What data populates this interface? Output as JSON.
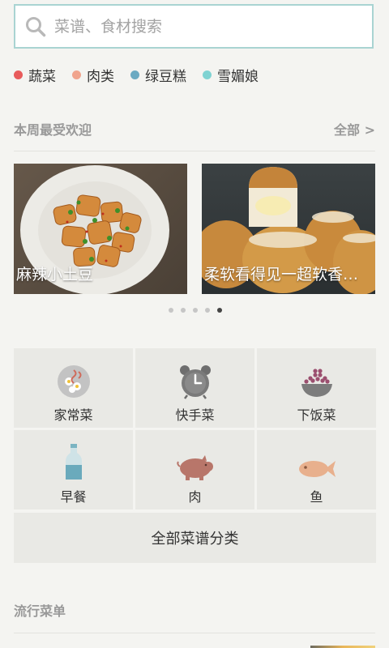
{
  "search": {
    "placeholder": "菜谱、食材搜索",
    "value": ""
  },
  "tags": [
    {
      "label": "蔬菜",
      "color": "#e85b5b"
    },
    {
      "label": "肉类",
      "color": "#f0a48d"
    },
    {
      "label": "绿豆糕",
      "color": "#6baac2"
    },
    {
      "label": "雪媚娘",
      "color": "#7fd3d2"
    }
  ],
  "weekly": {
    "title": "本周最受欢迎",
    "more_label": "全部 >"
  },
  "cards": [
    {
      "caption": "麻辣小土豆"
    },
    {
      "caption": "柔软看得见一超软香甜小面包"
    }
  ],
  "carousel": {
    "count": 5,
    "active_index": 4
  },
  "categories": [
    {
      "label": "家常菜",
      "icon": "home-dish-icon"
    },
    {
      "label": "快手菜",
      "icon": "alarm-clock-icon"
    },
    {
      "label": "下饭菜",
      "icon": "rice-bowl-icon"
    },
    {
      "label": "早餐",
      "icon": "milk-bottle-icon"
    },
    {
      "label": "肉",
      "icon": "pig-icon"
    },
    {
      "label": "鱼",
      "icon": "fish-icon"
    }
  ],
  "all_categories_label": "全部菜谱分类",
  "trending": {
    "title": "流行菜单"
  },
  "colors": {
    "accent_border": "#a9d4d2",
    "tile_bg": "#e9e9e5",
    "page_bg": "#f4f4f1"
  }
}
